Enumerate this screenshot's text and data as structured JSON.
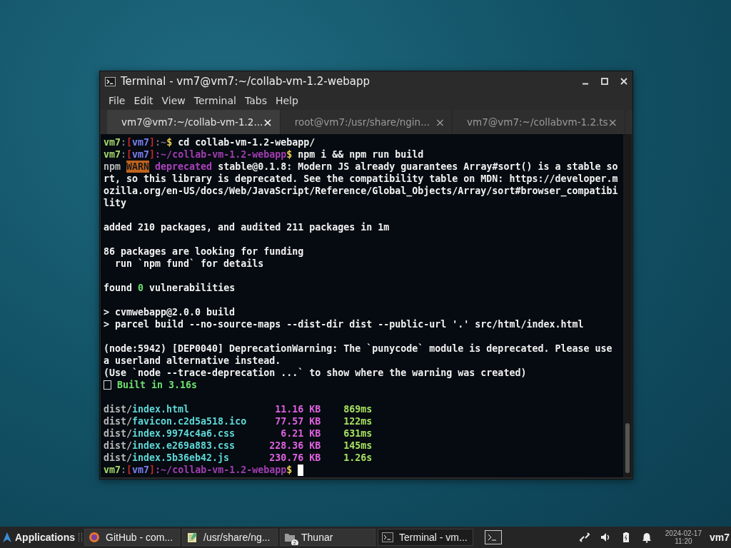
{
  "window": {
    "title": "Terminal - vm7@vm7:~/collab-vm-1.2-webapp"
  },
  "menu": [
    "File",
    "Edit",
    "View",
    "Terminal",
    "Tabs",
    "Help"
  ],
  "tabs": [
    {
      "label": "vm7@vm7:~/collab-vm-1.2...",
      "close": "×",
      "selected": true
    },
    {
      "label": "root@vm7:/usr/share/ngin...",
      "close": "×",
      "selected": false
    },
    {
      "label": "vm7@vm7:~/collabvm-1.2.ts",
      "close": "×",
      "selected": false
    }
  ],
  "terminal": {
    "cursor": true,
    "lines": [
      {
        "kind": "text",
        "segments": [
          {
            "text": "vm7",
            "kind": "user"
          },
          {
            "text": ":",
            "kind": "sep"
          },
          {
            "text": "[",
            "kind": "bracket"
          },
          {
            "text": "vm7",
            "kind": "host"
          },
          {
            "text": "]",
            "kind": "bracket"
          },
          {
            "text": ":~",
            "kind": "sep"
          },
          {
            "text": "$",
            "kind": "dollar"
          },
          {
            "text": " cd collab-vm-1.2-webapp/",
            "kind": "text"
          }
        ]
      },
      {
        "kind": "text",
        "segments": [
          {
            "text": "vm7",
            "kind": "user"
          },
          {
            "text": ":",
            "kind": "sep"
          },
          {
            "text": "[",
            "kind": "bracket"
          },
          {
            "text": "vm7",
            "kind": "host"
          },
          {
            "text": "]",
            "kind": "bracket"
          },
          {
            "text": ":~/collab-vm-1.2-webapp",
            "kind": "path"
          },
          {
            "text": "$",
            "kind": "dollar"
          },
          {
            "text": " npm i && npm run build",
            "kind": "text"
          }
        ]
      },
      {
        "kind": "text",
        "segments": [
          {
            "text": "npm ",
            "kind": "dim"
          },
          {
            "text": "WARN",
            "kind": "warn"
          },
          {
            "text": " deprecated",
            "kind": "deprecated"
          },
          {
            "text": " stable@0.1.8: Modern JS already guarantees Array#sort() is a stable so",
            "kind": "text"
          }
        ]
      },
      {
        "kind": "text",
        "segments": [
          {
            "text": "rt, so this library is deprecated. See the compatibility table on MDN: https://developer.m",
            "kind": "text"
          }
        ]
      },
      {
        "kind": "text",
        "segments": [
          {
            "text": "ozilla.org/en-US/docs/Web/JavaScript/Reference/Global_Objects/Array/sort#browser_compatibi",
            "kind": "text"
          }
        ]
      },
      {
        "kind": "text",
        "segments": [
          {
            "text": "lity",
            "kind": "text"
          }
        ]
      },
      {
        "kind": "blank"
      },
      {
        "kind": "text",
        "segments": [
          {
            "text": "added 210 packages, and audited 211 packages in 1m",
            "kind": "text"
          }
        ]
      },
      {
        "kind": "blank"
      },
      {
        "kind": "text",
        "segments": [
          {
            "text": "86 packages are looking for funding",
            "kind": "text"
          }
        ]
      },
      {
        "kind": "text",
        "segments": [
          {
            "text": "  run `npm fund` for details",
            "kind": "text"
          }
        ]
      },
      {
        "kind": "blank"
      },
      {
        "kind": "text",
        "segments": [
          {
            "text": "found ",
            "kind": "text"
          },
          {
            "text": "0",
            "kind": "ok"
          },
          {
            "text": " vulnerabilities",
            "kind": "text"
          }
        ]
      },
      {
        "kind": "blank"
      },
      {
        "kind": "text",
        "segments": [
          {
            "text": "> cvmwebapp@2.0.0 build",
            "kind": "text"
          }
        ]
      },
      {
        "kind": "text",
        "segments": [
          {
            "text": "> parcel build --no-source-maps --dist-dir dist --public-url '.' src/html/index.html",
            "kind": "text"
          }
        ]
      },
      {
        "kind": "blank"
      },
      {
        "kind": "text",
        "segments": [
          {
            "text": "(node:5942) [DEP0040] DeprecationWarning: The `punycode` module is deprecated. Please use",
            "kind": "text"
          }
        ]
      },
      {
        "kind": "text",
        "segments": [
          {
            "text": "a userland alternative instead.",
            "kind": "text"
          }
        ]
      },
      {
        "kind": "text",
        "segments": [
          {
            "text": "(Use `node --trace-deprecation ...` to show where the warning was created)",
            "kind": "text"
          }
        ]
      },
      {
        "kind": "text",
        "segments": [
          {
            "kind": "glyph"
          },
          {
            "text": " Built in 3.16s",
            "kind": "ok"
          }
        ]
      },
      {
        "kind": "blank"
      },
      {
        "kind": "file_row",
        "dir": "dist/",
        "file": "index.html",
        "size": "11.16 KB",
        "time": "869ms"
      },
      {
        "kind": "file_row",
        "dir": "dist/",
        "file": "favicon.c2d5a518.ico",
        "size": "77.57 KB",
        "time": "122ms"
      },
      {
        "kind": "file_row",
        "dir": "dist/",
        "file": "index.9974c4a6.css",
        "size": "6.21 KB",
        "time": "631ms"
      },
      {
        "kind": "file_row",
        "dir": "dist/",
        "file": "index.e269a883.css",
        "size": "228.36 KB",
        "time": "145ms"
      },
      {
        "kind": "file_row",
        "dir": "dist/",
        "file": "index.5b36eb42.js",
        "size": "230.76 KB",
        "time": "1.26s"
      },
      {
        "kind": "text",
        "segments": [
          {
            "text": "vm7",
            "kind": "user"
          },
          {
            "text": ":",
            "kind": "sep"
          },
          {
            "text": "[",
            "kind": "bracket"
          },
          {
            "text": "vm7",
            "kind": "host"
          },
          {
            "text": "]",
            "kind": "bracket"
          },
          {
            "text": ":~/collab-vm-1.2-webapp",
            "kind": "path"
          },
          {
            "text": "$",
            "kind": "dollar"
          }
        ]
      }
    ]
  },
  "taskbar": {
    "menu_label": "Applications",
    "tasks": [
      {
        "label": "GitHub - com...",
        "kind": "browser",
        "selected": false
      },
      {
        "label": "/usr/share/ng...",
        "kind": "editor",
        "selected": false
      },
      {
        "label": "Thunar",
        "kind": "folder",
        "badge": "2",
        "selected": false
      },
      {
        "label": "Terminal - vm...",
        "kind": "terminal",
        "selected": true
      }
    ],
    "date": "2024-02-17",
    "time": "11:20",
    "user": "vm7"
  }
}
